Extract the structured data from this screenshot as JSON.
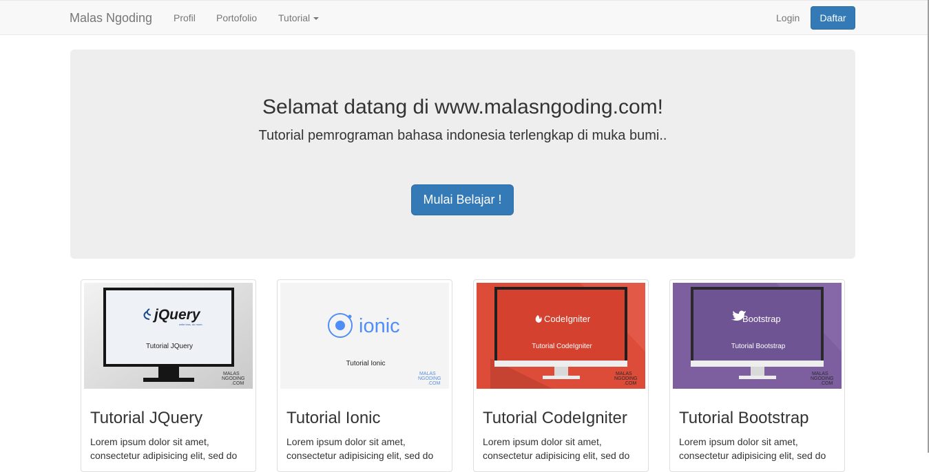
{
  "navbar": {
    "brand": "Malas Ngoding",
    "links": [
      "Profil",
      "Portofolio",
      "Tutorial"
    ],
    "login": "Login",
    "daftar": "Daftar"
  },
  "jumbotron": {
    "title": "Selamat datang di www.malasngoding.com!",
    "subtitle": "Tutorial pemrograman bahasa indonesia terlengkap di muka bumi..",
    "button": "Mulai Belajar !"
  },
  "cards": [
    {
      "title": "Tutorial JQuery",
      "text": "Lorem ipsum dolor sit amet, consectetur adipisicing elit, sed do",
      "logo": "jQuery",
      "logo_tagline": "write less, do more.",
      "caption": "Tutorial JQuery",
      "watermark": "MALAS NGODING .COM"
    },
    {
      "title": "Tutorial Ionic",
      "text": "Lorem ipsum dolor sit amet, consectetur adipisicing elit, sed do",
      "logo": "ionic",
      "caption": "Tutorial Ionic",
      "watermark": "MALAS NGODING .COM"
    },
    {
      "title": "Tutorial CodeIgniter",
      "text": "Lorem ipsum dolor sit amet, consectetur adipisicing elit, sed do",
      "logo": "CodeIgniter",
      "caption": "Tutorial CodeIgniter",
      "watermark": "MALAS NGODING .COM"
    },
    {
      "title": "Tutorial Bootstrap",
      "text": "Lorem ipsum dolor sit amet, consectetur adipisicing elit, sed do",
      "logo": "Bootstrap",
      "caption": "Tutorial Bootstrap",
      "watermark": "MALAS NGODING .COM"
    }
  ],
  "colors": {
    "primary": "#337ab7",
    "navbar_bg": "#f8f8f8",
    "jumbotron_bg": "#eeeeee",
    "codeigniter_red": "#dd4b39",
    "bootstrap_purple": "#7d5f9f"
  },
  "icons": [
    "caret-down-icon",
    "ionic-logo-icon",
    "flame-icon",
    "twitter-bird-icon"
  ]
}
